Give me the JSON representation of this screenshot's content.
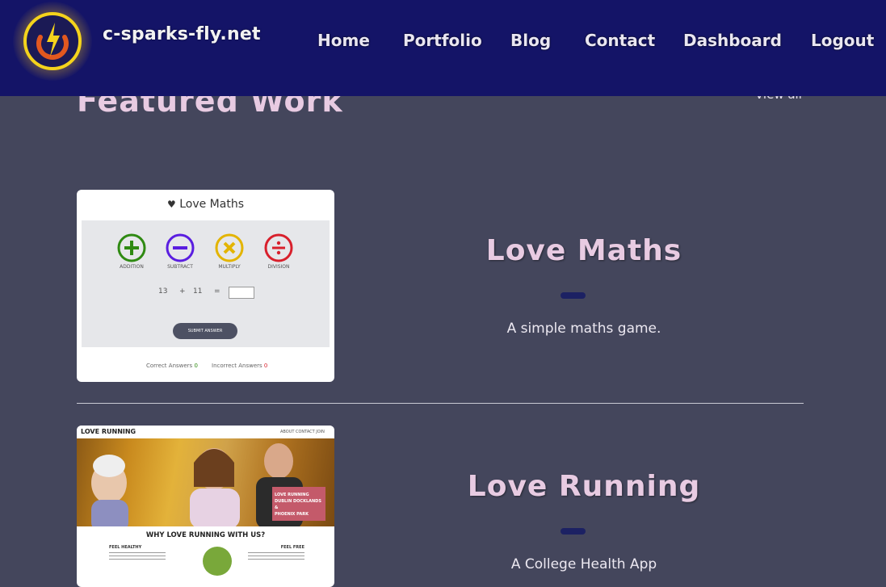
{
  "header": {
    "site_name": "c-sparks-fly.net",
    "brand_color": "#141467",
    "logo_icon": "power-bolt-icon",
    "nav": [
      "Home",
      "Portfolio",
      "Blog",
      "Contact",
      "Dashboard",
      "Logout"
    ]
  },
  "featured": {
    "title": "Featured Work",
    "view_all": "View all"
  },
  "projects": [
    {
      "title": "Love Maths",
      "description": "A simple maths game.",
      "preview": {
        "header": "Love Maths",
        "operations": [
          "ADDITION",
          "SUBTRACT",
          "MULTIPLY",
          "DIVISION"
        ],
        "operand1": "13",
        "operator": "+",
        "operand2": "11",
        "equals": "=",
        "submit": "SUBMIT ANSWER",
        "correct_label": "Correct Answers",
        "correct_value": "0",
        "incorrect_label": "Incorrect Answers",
        "incorrect_value": "0"
      }
    },
    {
      "title": "Love Running",
      "description": "A College Health App",
      "preview": {
        "brand": "LOVE RUNNING",
        "nav": "ABOUT  CONTACT  JOIN",
        "banner_line1": "LOVE RUNNING",
        "banner_line2": "DUBLIN DOCKLANDS &",
        "banner_line3": "PHOENIX PARK",
        "why": "WHY LOVE RUNNING WITH US?",
        "col_left": "FEEL HEALTHY",
        "col_right": "FEEL FREE"
      }
    }
  ]
}
